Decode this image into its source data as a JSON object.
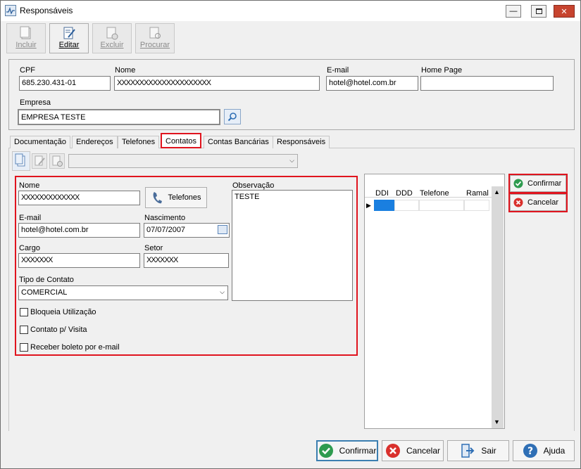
{
  "window": {
    "title": "Responsáveis"
  },
  "toolbar": {
    "incluir": "Incluir",
    "editar": "Editar",
    "excluir": "Excluir",
    "procurar": "Procurar"
  },
  "header_form": {
    "cpf_label": "CPF",
    "cpf_value": "685.230.431-01",
    "nome_label": "Nome",
    "nome_value": "XXXXXXXXXXXXXXXXXXXXX",
    "email_label": "E-mail",
    "email_value": "hotel@hotel.com.br",
    "homepage_label": "Home Page",
    "homepage_value": "",
    "empresa_label": "Empresa",
    "empresa_value": "EMPRESA TESTE"
  },
  "tabs": [
    "Documentação",
    "Endereços",
    "Telefones",
    "Contatos",
    "Contas Bancárias",
    "Responsáveis"
  ],
  "contact_form": {
    "nome_label": "Nome",
    "nome_value": "XXXXXXXXXXXXX",
    "telefones_button": "Telefones",
    "observacao_label": "Observação",
    "observacao_value": "TESTE",
    "email_label": "E-mail",
    "email_value": "hotel@hotel.com.br",
    "nascimento_label": "Nascimento",
    "nascimento_value": "07/07/2007",
    "cargo_label": "Cargo",
    "cargo_value": "XXXXXXX",
    "setor_label": "Setor",
    "setor_value": "XXXXXXX",
    "tipo_label": "Tipo de Contato",
    "tipo_value": "COMERCIAL",
    "check_bloqueia": "Bloqueia Utilização",
    "check_visita": "Contato p/ Visita",
    "check_boleto": "Receber boleto por e-mail"
  },
  "phone_grid": {
    "columns": [
      "DDI",
      "DDD",
      "Telefone",
      "Ramal"
    ]
  },
  "side_buttons": {
    "confirmar": "Confirmar",
    "cancelar": "Cancelar"
  },
  "bottom_buttons": {
    "confirmar": "Confirmar",
    "cancelar": "Cancelar",
    "sair": "Sair",
    "ajuda": "Ajuda"
  },
  "colors": {
    "highlight": "#e0141e",
    "confirm": "#2e9b4f",
    "cancel": "#d9302c",
    "help": "#2f6fb5"
  }
}
